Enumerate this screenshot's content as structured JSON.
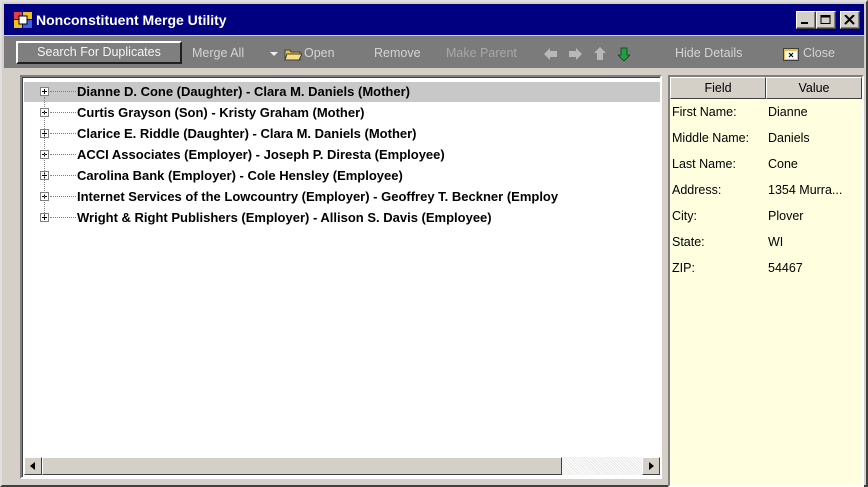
{
  "window": {
    "title": "Nonconstituent Merge Utility",
    "caption_buttons": [
      "minimize-icon",
      "maximize-icon",
      "close-icon"
    ]
  },
  "toolbar": {
    "search_label": "Search For Duplicates",
    "merge_all_label": "Merge All",
    "open_label": "Open",
    "remove_label": "Remove",
    "make_parent_label": "Make Parent",
    "hide_details_label": "Hide Details",
    "close_label": "Close"
  },
  "tree": {
    "selected_index": 0,
    "items": [
      {
        "label": "Dianne D. Cone (Daughter) - Clara M. Daniels (Mother)"
      },
      {
        "label": "Curtis Grayson (Son) - Kristy Graham (Mother)"
      },
      {
        "label": "Clarice E. Riddle (Daughter) - Clara M. Daniels (Mother)"
      },
      {
        "label": "ACCI Associates (Employer) - Joseph P. Diresta (Employee)"
      },
      {
        "label": "Carolina Bank (Employer) - Cole Hensley (Employee)"
      },
      {
        "label": "Internet Services of the Lowcountry (Employer) - Geoffrey T. Beckner (Employ"
      },
      {
        "label": "Wright & Right Publishers (Employer) - Allison S. Davis (Employee)"
      }
    ]
  },
  "details": {
    "columns": {
      "field": "Field",
      "value": "Value"
    },
    "rows": [
      {
        "field": "First Name:",
        "value": "Dianne"
      },
      {
        "field": "Middle Name:",
        "value": "Daniels"
      },
      {
        "field": "Last Name:",
        "value": "Cone"
      },
      {
        "field": "Address:",
        "value": "1354 Murra..."
      },
      {
        "field": "City:",
        "value": "Plover"
      },
      {
        "field": "State:",
        "value": "WI"
      },
      {
        "field": "ZIP:",
        "value": "54467"
      }
    ]
  },
  "colors": {
    "titlebar": "#000080",
    "toolbar": "#7b7b7b",
    "details_bg": "#ffffe0",
    "selection": "#c8c8c8"
  }
}
